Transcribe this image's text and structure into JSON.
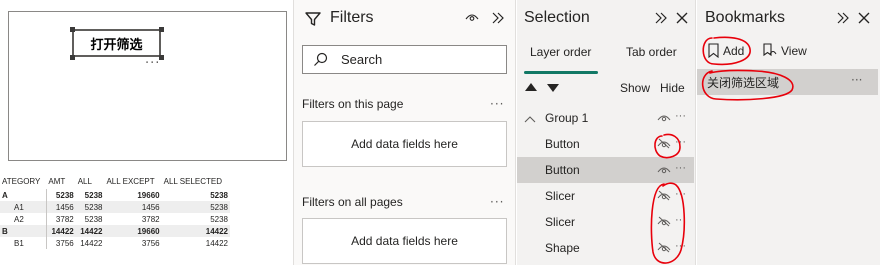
{
  "canvas": {
    "button_text": "打开筛选",
    "matrix": {
      "headers": [
        "ATEGORY",
        "AMT",
        "ALL",
        "ALL EXCEPT",
        "ALL SELECTED"
      ],
      "rows": [
        {
          "cells": [
            "A",
            "5238",
            "5238",
            "19660",
            "5238"
          ],
          "bold": true,
          "shade": false,
          "sub": false
        },
        {
          "cells": [
            "A1",
            "1456",
            "5238",
            "1456",
            "5238"
          ],
          "bold": false,
          "shade": true,
          "sub": true
        },
        {
          "cells": [
            "A2",
            "3782",
            "5238",
            "3782",
            "5238"
          ],
          "bold": false,
          "shade": false,
          "sub": true
        },
        {
          "cells": [
            "B",
            "14422",
            "14422",
            "19660",
            "14422"
          ],
          "bold": true,
          "shade": true,
          "sub": false
        },
        {
          "cells": [
            "B1",
            "3756",
            "14422",
            "3756",
            "14422"
          ],
          "bold": false,
          "shade": false,
          "sub": true
        }
      ]
    }
  },
  "filters": {
    "title": "Filters",
    "search_placeholder": "Search",
    "on_this_page_label": "Filters on this page",
    "on_all_pages_label": "Filters on all pages",
    "drop_zone_text": "Add data fields here",
    "more": "···"
  },
  "selection": {
    "title": "Selection",
    "tabs": [
      "Layer order",
      "Tab order"
    ],
    "show_label": "Show",
    "hide_label": "Hide",
    "layers": [
      {
        "label": "Group 1",
        "type": "group",
        "hidden": false,
        "selected": false
      },
      {
        "label": "Button",
        "type": "child",
        "hidden": true,
        "selected": false
      },
      {
        "label": "Button",
        "type": "child",
        "hidden": false,
        "selected": true
      },
      {
        "label": "Slicer",
        "type": "child",
        "hidden": true,
        "selected": false
      },
      {
        "label": "Slicer",
        "type": "child",
        "hidden": true,
        "selected": false
      },
      {
        "label": "Shape",
        "type": "child",
        "hidden": true,
        "selected": false
      }
    ],
    "more": "···"
  },
  "bookmarks": {
    "title": "Bookmarks",
    "add_label": "Add",
    "view_label": "View",
    "items": [
      "关闭筛选区域"
    ],
    "more": "···"
  },
  "colors": {
    "accent_tab": "#117865",
    "annotation": "#e8000b",
    "pane_bg": "#f3f2f1",
    "selected_row": "#d2d0ce"
  }
}
